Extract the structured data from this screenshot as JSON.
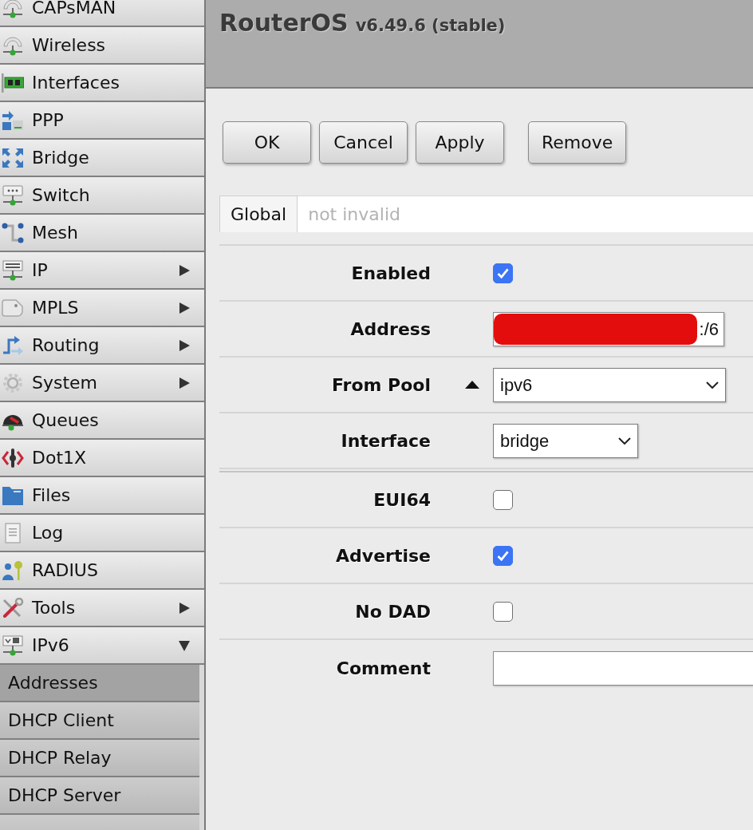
{
  "sidebar": {
    "items": [
      {
        "label": "CAPsMAN",
        "kind": "plain"
      },
      {
        "label": "Wireless",
        "kind": "plain"
      },
      {
        "label": "Interfaces",
        "kind": "plain"
      },
      {
        "label": "PPP",
        "kind": "plain"
      },
      {
        "label": "Bridge",
        "kind": "plain"
      },
      {
        "label": "Switch",
        "kind": "plain"
      },
      {
        "label": "Mesh",
        "kind": "plain"
      },
      {
        "label": "IP",
        "kind": "submenu",
        "expanded": false
      },
      {
        "label": "MPLS",
        "kind": "submenu",
        "expanded": false
      },
      {
        "label": "Routing",
        "kind": "submenu",
        "expanded": false
      },
      {
        "label": "System",
        "kind": "submenu",
        "expanded": false
      },
      {
        "label": "Queues",
        "kind": "plain"
      },
      {
        "label": "Dot1X",
        "kind": "plain"
      },
      {
        "label": "Files",
        "kind": "plain"
      },
      {
        "label": "Log",
        "kind": "plain"
      },
      {
        "label": "RADIUS",
        "kind": "plain"
      },
      {
        "label": "Tools",
        "kind": "submenu",
        "expanded": false
      },
      {
        "label": "IPv6",
        "kind": "submenu",
        "expanded": true,
        "children": [
          {
            "label": "Addresses",
            "selected": true
          },
          {
            "label": "DHCP Client",
            "selected": false
          },
          {
            "label": "DHCP Relay",
            "selected": false
          },
          {
            "label": "DHCP Server",
            "selected": false
          },
          {
            "selected": false
          }
        ]
      }
    ]
  },
  "header": {
    "title": "RouterOS",
    "version": "v6.49.6 (stable)"
  },
  "button_groups": [
    {
      "buttons": [
        "OK",
        "Cancel",
        "Apply"
      ]
    },
    {
      "buttons": [
        "Remove"
      ]
    }
  ],
  "tabs": [
    {
      "label": "Global",
      "selected": true
    }
  ],
  "status": "not invalid",
  "form": {
    "sections": [
      {
        "fields": [
          {
            "label": "Enabled",
            "kind": "checkbox",
            "checked": true
          },
          {
            "label": "Address",
            "kind": "text",
            "value": ":/6",
            "redacted": true
          },
          {
            "label": "From Pool",
            "kind": "select-wide",
            "value": "ipv6",
            "collapse_arrow": true
          },
          {
            "label": "Interface",
            "kind": "select-narrow",
            "value": "bridge"
          }
        ]
      },
      {
        "fields": [
          {
            "label": "EUI64",
            "kind": "checkbox",
            "checked": false
          },
          {
            "label": "Advertise",
            "kind": "checkbox",
            "checked": true
          },
          {
            "label": "No DAD",
            "kind": "checkbox",
            "checked": false
          },
          {
            "label": "Comment",
            "kind": "text-wide"
          }
        ]
      }
    ]
  }
}
